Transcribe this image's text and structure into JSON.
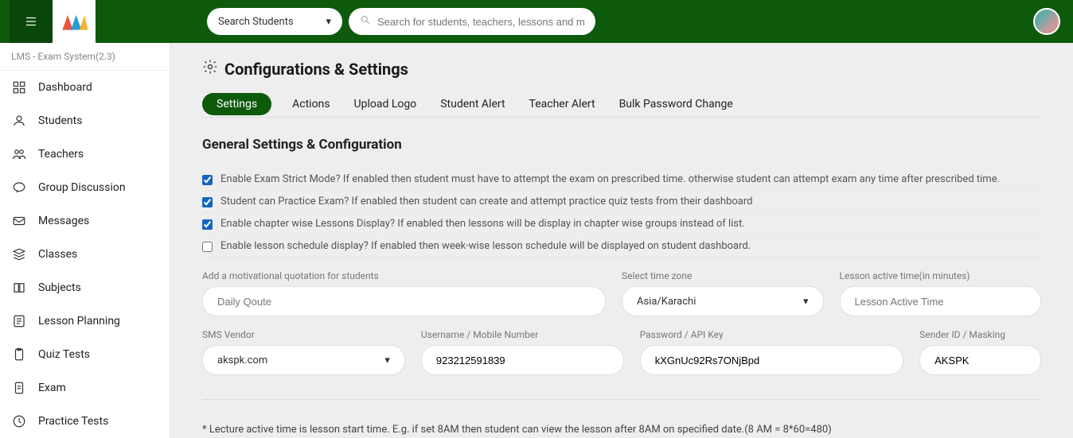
{
  "header": {
    "search_dropdown": "Search Students",
    "search_placeholder": "Search for students, teachers, lessons and more.."
  },
  "sidebar": {
    "system_label": "LMS - Exam System(2.3)",
    "items": [
      {
        "label": "Dashboard"
      },
      {
        "label": "Students"
      },
      {
        "label": "Teachers"
      },
      {
        "label": "Group Discussion"
      },
      {
        "label": "Messages"
      },
      {
        "label": "Classes"
      },
      {
        "label": "Subjects"
      },
      {
        "label": "Lesson Planning"
      },
      {
        "label": "Quiz Tests"
      },
      {
        "label": "Exam"
      },
      {
        "label": "Practice Tests"
      }
    ]
  },
  "page": {
    "title": "Configurations & Settings",
    "tabs": [
      {
        "label": "Settings"
      },
      {
        "label": "Actions"
      },
      {
        "label": "Upload Logo"
      },
      {
        "label": "Student Alert"
      },
      {
        "label": "Teacher Alert"
      },
      {
        "label": "Bulk Password Change"
      }
    ],
    "section_heading": "General Settings & Configuration",
    "checks": [
      {
        "label": "Enable Exam Strict Mode? If enabled then student must have to attempt the exam on prescribed time. otherwise student can attempt exam any time after prescribed time.",
        "checked": true
      },
      {
        "label": "Student can Practice Exam? If enabled then student can create and attempt practice quiz tests from their dashboard",
        "checked": true
      },
      {
        "label": "Enable chapter wise Lessons Display? If enabled then lessons will be display in chapter wise groups instead of list.",
        "checked": true
      },
      {
        "label": "Enable lesson schedule display? If enabled then week-wise lesson schedule will be displayed on student dashboard.",
        "checked": false
      }
    ],
    "fields": {
      "quote_label": "Add a motivational quotation for students",
      "quote_placeholder": "Daily Qoute",
      "tz_label": "Select time zone",
      "tz_value": "Asia/Karachi",
      "lesson_active_label": "Lesson active time(in minutes)",
      "lesson_active_placeholder": "Lesson Active Time",
      "sms_vendor_label": "SMS Vendor",
      "sms_vendor_value": "akspk.com",
      "username_label": "Username / Mobile Number",
      "username_value": "923212591839",
      "password_label": "Password / API Key",
      "password_value": "kXGnUc92Rs7ONjBpd",
      "sender_label": "Sender ID / Masking",
      "sender_value": "AKSPK"
    },
    "footnote": "* Lecture active time is lesson start time. E.g. if set 8AM then student can view the lesson after 8AM on specified date.(8 AM = 8*60=480)"
  }
}
